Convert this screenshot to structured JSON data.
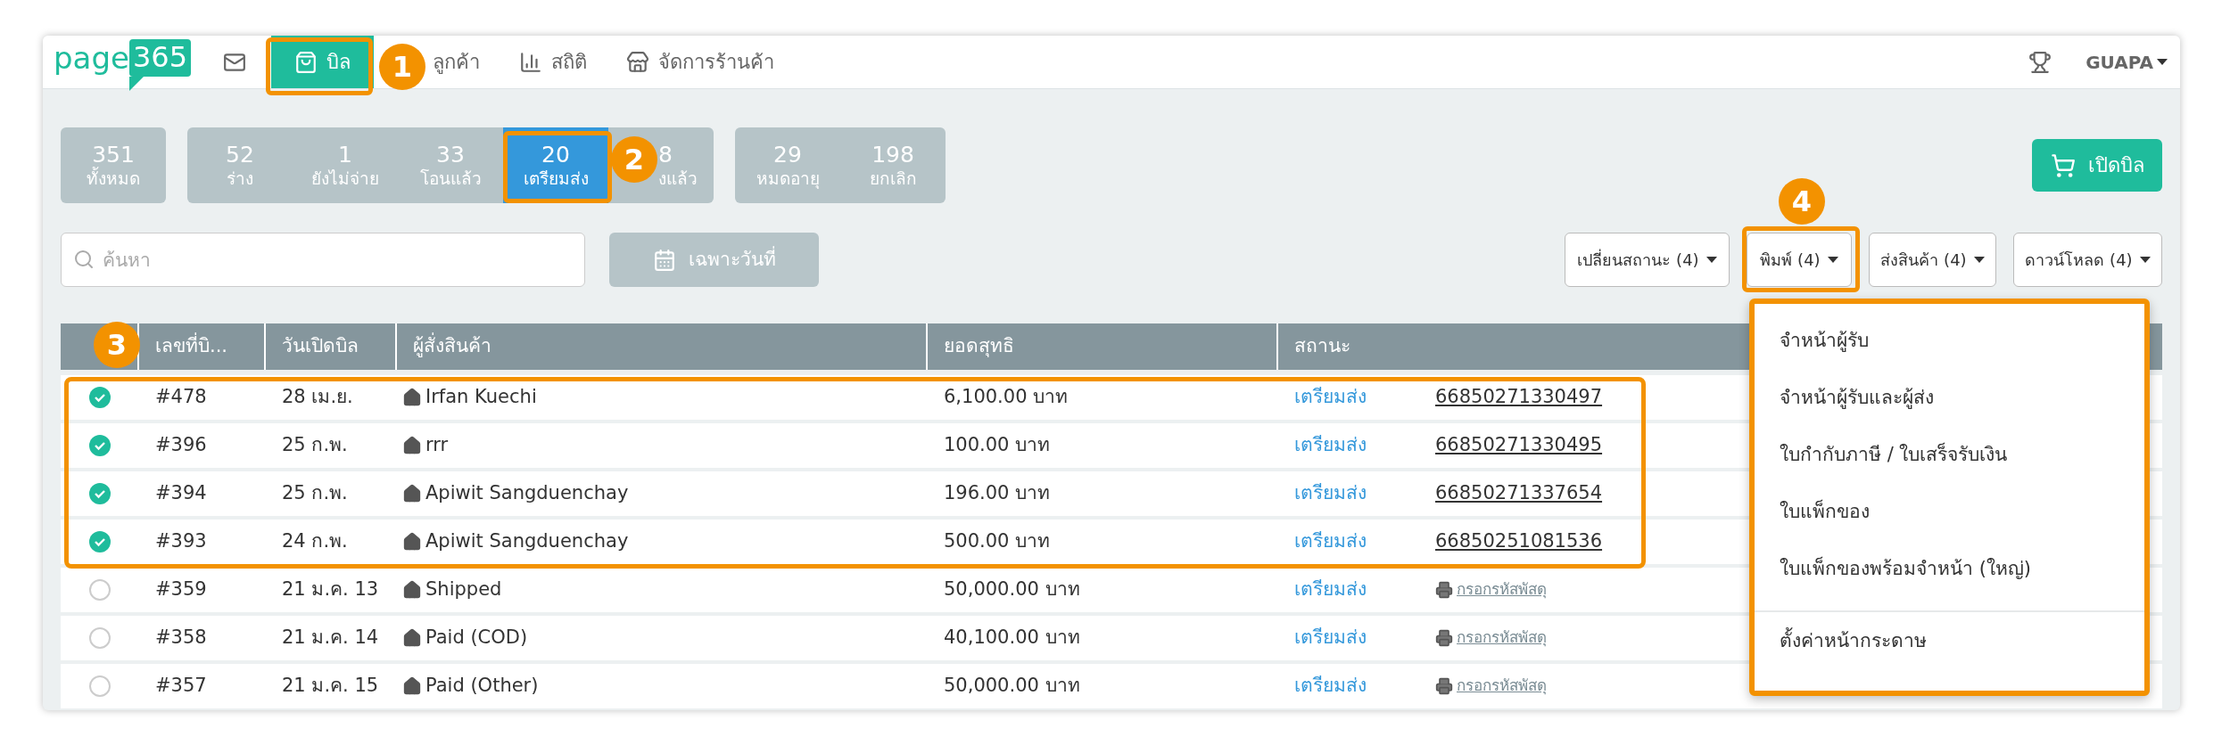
{
  "logo": {
    "text": "page",
    "badge": "365"
  },
  "nav": [
    {
      "kind": "mail",
      "selected": false
    },
    {
      "kind": "bag",
      "label": "บิล",
      "selected": true
    },
    {
      "kind": "plain",
      "label": "ลูกค้า",
      "selected": false
    },
    {
      "kind": "chart",
      "label": "สถิติ",
      "selected": false
    },
    {
      "kind": "store",
      "label": "จัดการร้านค้า",
      "selected": false
    }
  ],
  "user": {
    "name": "GUAPA"
  },
  "status_groups": [
    [
      {
        "count": "351",
        "label": "ทั้งหมด",
        "selected": false
      }
    ],
    [
      {
        "count": "52",
        "label": "ร่าง",
        "selected": false
      },
      {
        "count": "1",
        "label": "ยังไม่จ่าย",
        "selected": false
      },
      {
        "count": "33",
        "label": "โอนแล้ว",
        "selected": false
      },
      {
        "count": "20",
        "label": "เตรียมส่ง",
        "selected": true
      },
      {
        "count": "8",
        "label": "งแล้ว",
        "selected": false
      }
    ],
    [
      {
        "count": "29",
        "label": "หมดอายุ",
        "selected": false
      },
      {
        "count": "198",
        "label": "ยกเลิก",
        "selected": false
      }
    ]
  ],
  "new_bill_button": "เปิดบิล",
  "search": {
    "placeholder": "ค้นหา"
  },
  "date_button": "เฉพาะวันที่",
  "action_buttons": [
    "เปลี่ยนสถานะ (4)",
    "พิมพ์ (4)",
    "ส่งสินค้า (4)",
    "ดาวน์โหลด (4)"
  ],
  "print_menu": {
    "items": [
      "จำหน้าผู้รับ",
      "จำหน้าผู้รับและผู้ส่ง",
      "ใบกำกับภาษี / ใบเสร็จรับเงิน",
      "ใบแพ็กของ",
      "ใบแพ็กของพร้อมจำหน้า (ใหญ่)"
    ],
    "footer": "ตั้งค่าหน้ากระดาษ"
  },
  "table": {
    "columns": [
      "เลขที่บิ...",
      "วันเปิดบิล",
      "ผู้สั่งสินค้า",
      "ยอดสุทธิ",
      "สถานะ"
    ],
    "rows": [
      {
        "checked": true,
        "number": "#478",
        "date": "28 เม.ย.",
        "customer": "Irfan Kuechi",
        "total": "6,100.00 บาท",
        "status": "เตรียมส่ง",
        "kind": "tracking",
        "tracking": "66850271330497"
      },
      {
        "checked": true,
        "number": "#396",
        "date": "25 ก.พ.",
        "customer": "rrr",
        "total": "100.00 บาท",
        "status": "เตรียมส่ง",
        "kind": "tracking",
        "tracking": "66850271330495"
      },
      {
        "checked": true,
        "number": "#394",
        "date": "25 ก.พ.",
        "customer": "Apiwit Sangduenchay",
        "total": "196.00 บาท",
        "status": "เตรียมส่ง",
        "kind": "tracking",
        "tracking": "66850271337654"
      },
      {
        "checked": true,
        "number": "#393",
        "date": "24 ก.พ.",
        "customer": "Apiwit Sangduenchay",
        "total": "500.00 บาท",
        "status": "เตรียมส่ง",
        "kind": "tracking",
        "tracking": "66850251081536"
      },
      {
        "checked": false,
        "number": "#359",
        "date": "21 ม.ค. 13",
        "customer": "Shipped",
        "total": "50,000.00 บาท",
        "status": "เตรียมส่ง",
        "kind": "prompt",
        "tracking": "กรอกรหัสพัสดุ"
      },
      {
        "checked": false,
        "number": "#358",
        "date": "21 ม.ค. 14",
        "customer": "Paid (COD)",
        "total": "40,100.00 บาท",
        "status": "เตรียมส่ง",
        "kind": "prompt",
        "tracking": "กรอกรหัสพัสดุ"
      },
      {
        "checked": false,
        "number": "#357",
        "date": "21 ม.ค. 15",
        "customer": "Paid (Other)",
        "total": "50,000.00 บาท",
        "status": "เตรียมส่ง",
        "kind": "prompt",
        "tracking": "กรอกรหัสพัสดุ"
      }
    ]
  },
  "annotations": [
    "1",
    "2",
    "3",
    "4"
  ]
}
